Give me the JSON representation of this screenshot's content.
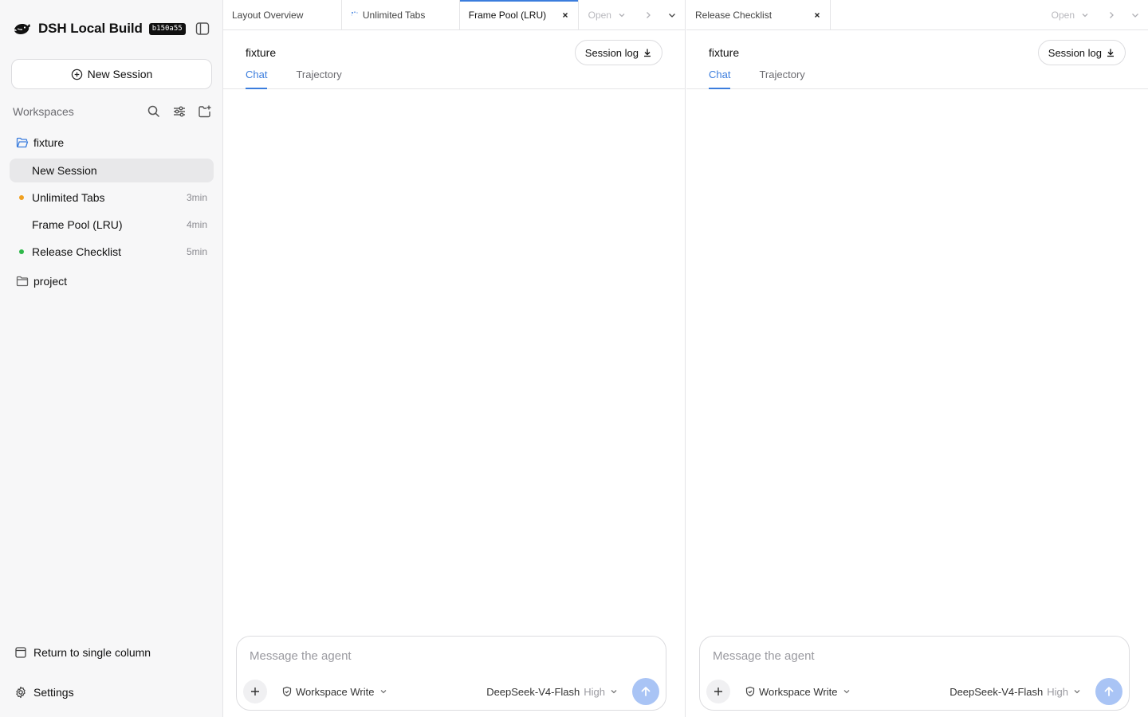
{
  "app": {
    "title": "DSH Local Build",
    "build_badge": "b150a55"
  },
  "sidebar": {
    "new_session_label": "New Session",
    "workspaces_label": "Workspaces",
    "tree": [
      {
        "type": "folder",
        "label": "fixture",
        "color": "#3b7ddd"
      },
      {
        "type": "session",
        "label": "New Session",
        "time": "",
        "dot": "",
        "active": true
      },
      {
        "type": "session",
        "label": "Unlimited Tabs",
        "time": "3min",
        "dot": "#f0a020"
      },
      {
        "type": "session",
        "label": "Frame Pool (LRU)",
        "time": "4min",
        "dot": ""
      },
      {
        "type": "session",
        "label": "Release Checklist",
        "time": "5min",
        "dot": "#2eb84a"
      },
      {
        "type": "folder",
        "label": "project",
        "color": "#666666"
      }
    ],
    "return_label": "Return to single column",
    "settings_label": "Settings"
  },
  "panes": {
    "left": {
      "tabs": [
        {
          "label": "Layout Overview",
          "active": false
        },
        {
          "label": "Unlimited Tabs",
          "active": false,
          "loading": true
        },
        {
          "label": "Frame Pool (LRU)",
          "active": true
        }
      ],
      "open_label": "Open",
      "title": "fixture",
      "session_log_label": "Session log",
      "subtabs": [
        "Chat",
        "Trajectory"
      ],
      "composer": {
        "placeholder": "Message the agent",
        "permission": "Workspace Write",
        "model": "DeepSeek-V4-Flash",
        "effort": "High"
      }
    },
    "right": {
      "tabs": [
        {
          "label": "Release Checklist",
          "active": false
        }
      ],
      "open_label": "Open",
      "title": "fixture",
      "session_log_label": "Session log",
      "subtabs": [
        "Chat",
        "Trajectory"
      ],
      "composer": {
        "placeholder": "Message the agent",
        "permission": "Workspace Write",
        "model": "DeepSeek-V4-Flash",
        "effort": "High"
      }
    }
  },
  "colors": {
    "accent": "#3b7ddd",
    "send_disabled": "#a9c4f5"
  }
}
